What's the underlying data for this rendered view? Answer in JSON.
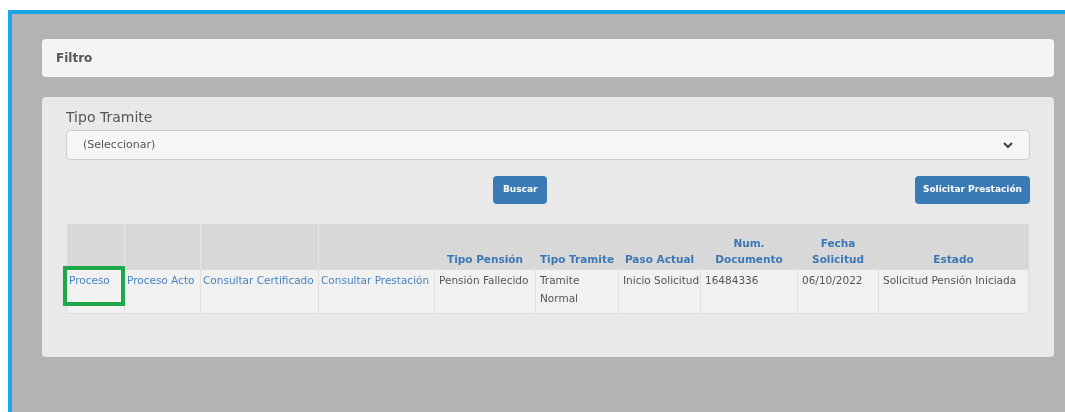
{
  "filter": {
    "title": "Filtro"
  },
  "form": {
    "label": "Tipo Tramite",
    "select_value": "(Seleccionar)",
    "search_button": "Buscar",
    "request_button": "Solicitar Prestación"
  },
  "table": {
    "columns": [
      "Tipo Pensión",
      "Tipo Tramite",
      "Paso Actual",
      "Num. Documento",
      "Fecha Solicitud",
      "Estado"
    ],
    "rows": [
      {
        "links": [
          {
            "label": "Proceso",
            "highlighted": true
          },
          {
            "label": "Proceso Acto",
            "highlighted": false
          },
          {
            "label": "Consultar Certificado",
            "highlighted": false
          },
          {
            "label": "Consultar Prestación",
            "highlighted": false
          }
        ],
        "cells": [
          "Pensión Fallecido",
          "Tramite Normal",
          "Inicio Solicitud",
          "16484336",
          "06/10/2022",
          "Solicitud Pensión Iniciada"
        ]
      }
    ]
  }
}
